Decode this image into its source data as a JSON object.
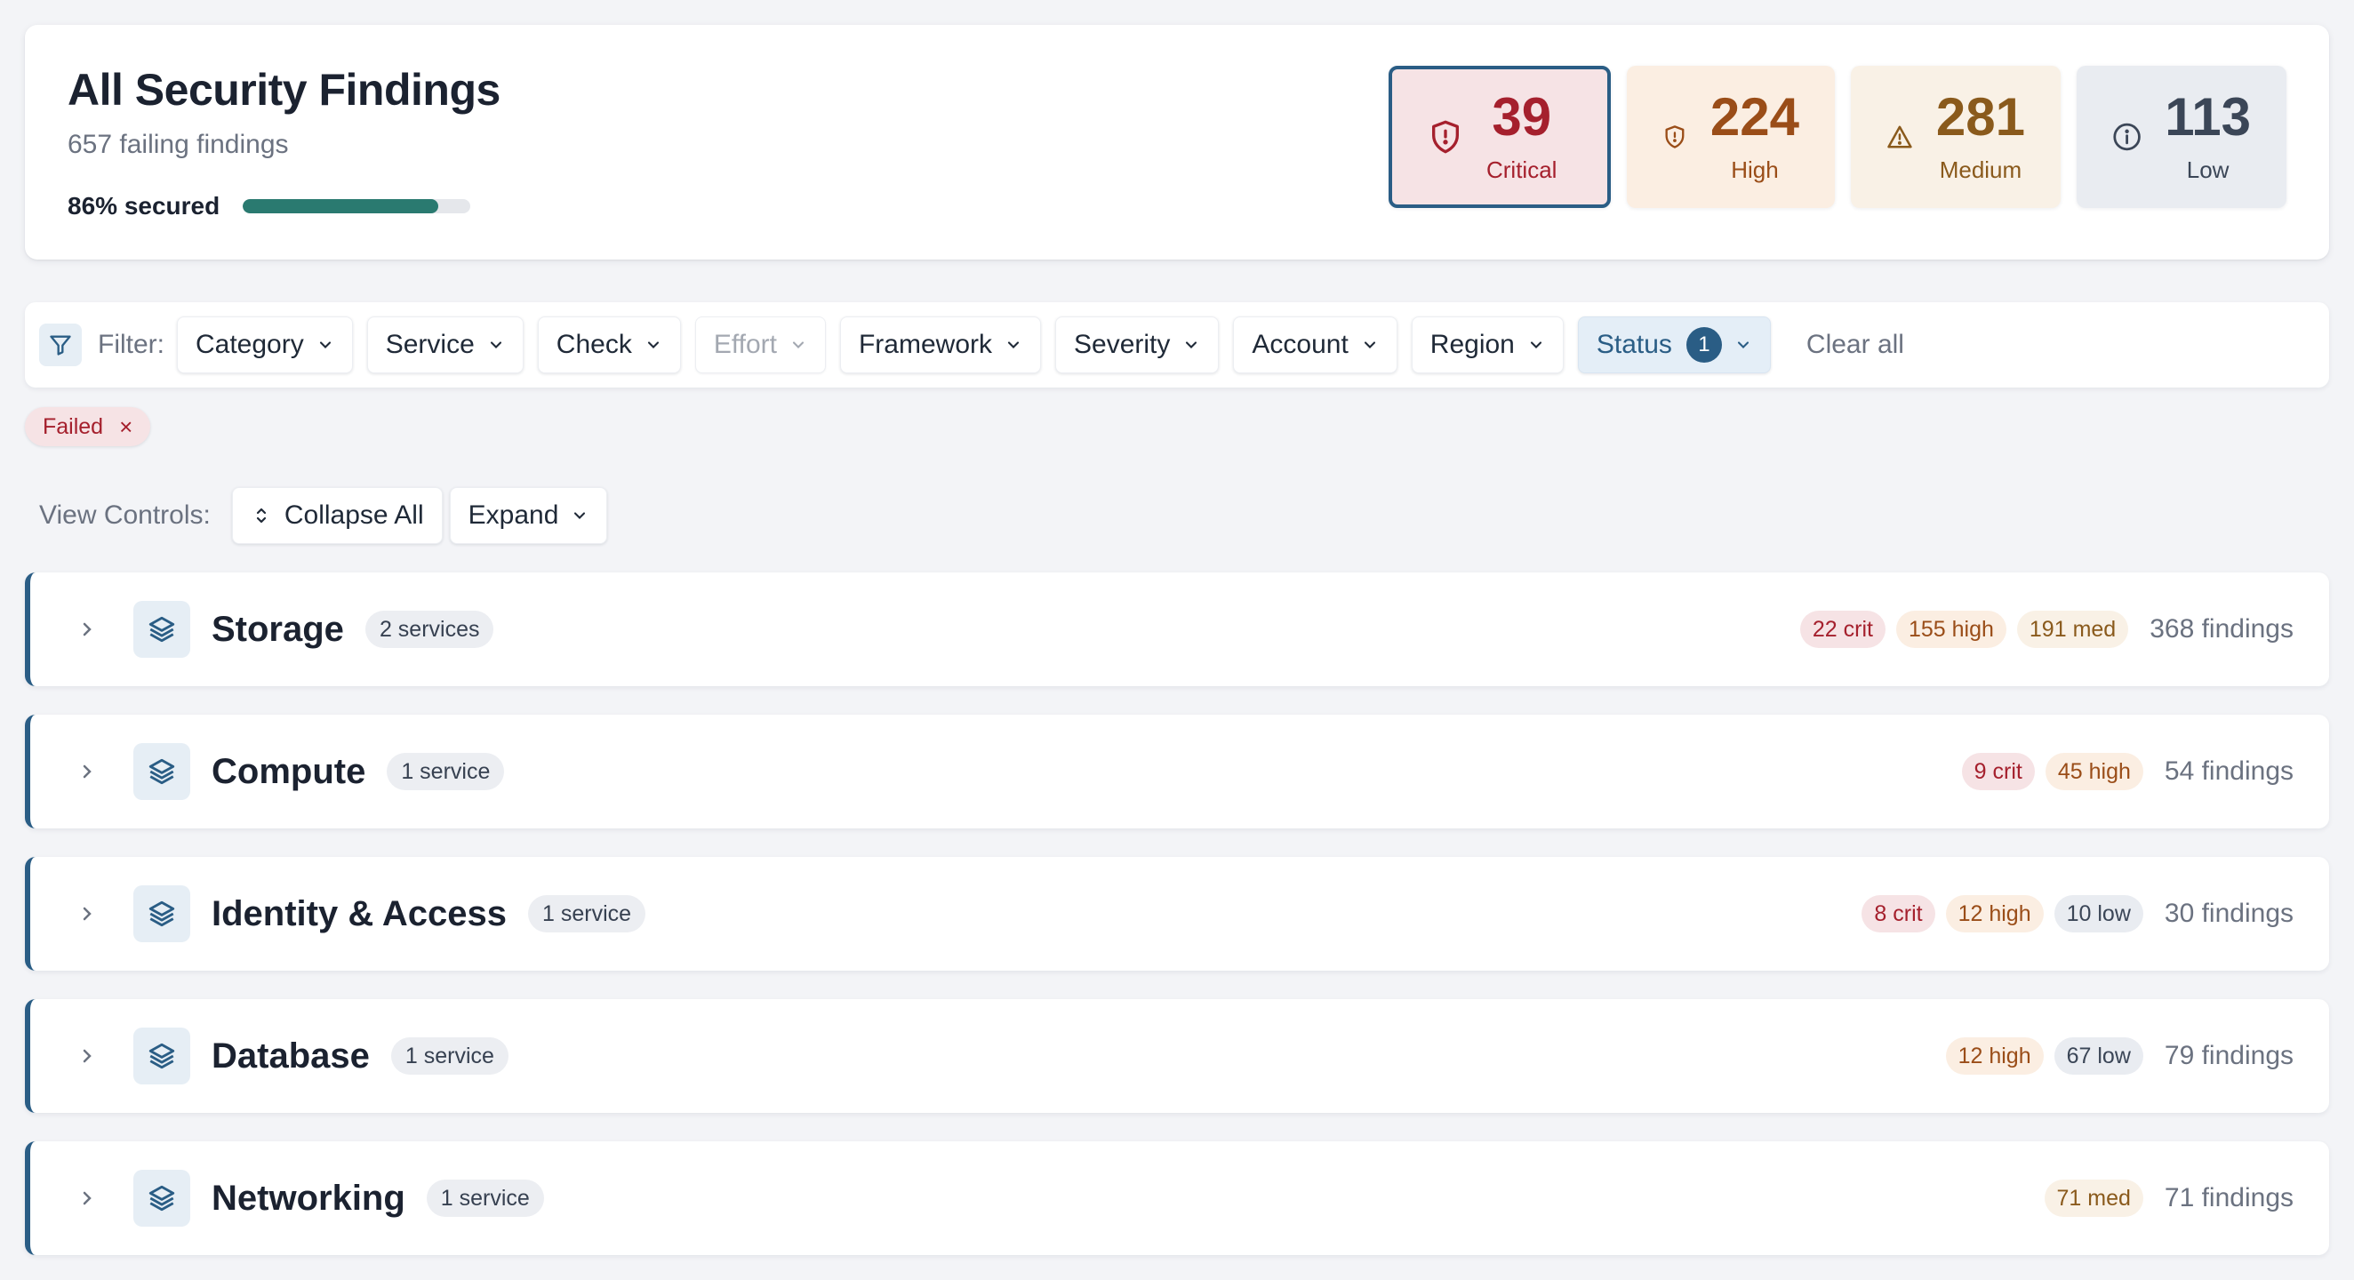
{
  "header": {
    "title": "All Security Findings",
    "subtitle": "657 failing findings",
    "secured_label": "86% secured",
    "secured_fraction": 0.86
  },
  "severity_cards": [
    {
      "key": "critical",
      "count": "39",
      "label": "Critical",
      "icon": "shield-alert-icon"
    },
    {
      "key": "high",
      "count": "224",
      "label": "High",
      "icon": "shield-alert-icon"
    },
    {
      "key": "medium",
      "count": "281",
      "label": "Medium",
      "icon": "warning-triangle-icon"
    },
    {
      "key": "low",
      "count": "113",
      "label": "Low",
      "icon": "info-circle-icon"
    }
  ],
  "filters": {
    "label": "Filter:",
    "buttons": [
      {
        "label": "Category",
        "state": "normal"
      },
      {
        "label": "Service",
        "state": "normal"
      },
      {
        "label": "Check",
        "state": "normal"
      },
      {
        "label": "Effort",
        "state": "disabled"
      },
      {
        "label": "Framework",
        "state": "normal"
      },
      {
        "label": "Severity",
        "state": "normal"
      },
      {
        "label": "Account",
        "state": "normal"
      },
      {
        "label": "Region",
        "state": "normal"
      },
      {
        "label": "Status",
        "state": "active",
        "count": "1"
      }
    ],
    "clear_all": "Clear all"
  },
  "active_chips": [
    {
      "label": "Failed",
      "remove_icon": "close-icon"
    }
  ],
  "view_controls": {
    "label": "View Controls:",
    "collapse_all": "Collapse All",
    "expand": "Expand"
  },
  "categories": [
    {
      "name": "Storage",
      "services": "2 services",
      "pills": [
        {
          "type": "crit",
          "text": "22 crit"
        },
        {
          "type": "high",
          "text": "155 high"
        },
        {
          "type": "med",
          "text": "191 med"
        }
      ],
      "findings": "368 findings"
    },
    {
      "name": "Compute",
      "services": "1 service",
      "pills": [
        {
          "type": "crit",
          "text": "9 crit"
        },
        {
          "type": "high",
          "text": "45 high"
        }
      ],
      "findings": "54 findings"
    },
    {
      "name": "Identity & Access",
      "services": "1 service",
      "pills": [
        {
          "type": "crit",
          "text": "8 crit"
        },
        {
          "type": "high",
          "text": "12 high"
        },
        {
          "type": "low",
          "text": "10 low"
        }
      ],
      "findings": "30 findings"
    },
    {
      "name": "Database",
      "services": "1 service",
      "pills": [
        {
          "type": "high",
          "text": "12 high"
        },
        {
          "type": "low",
          "text": "67 low"
        }
      ],
      "findings": "79 findings"
    },
    {
      "name": "Networking",
      "services": "1 service",
      "pills": [
        {
          "type": "med",
          "text": "71 med"
        }
      ],
      "findings": "71 findings"
    }
  ],
  "colors": {
    "accent": "#2a5d85",
    "progress": "#2a7a70",
    "critical": "#a5202d",
    "high": "#9a4d18",
    "medium": "#8a5a1c",
    "low": "#3b4657"
  }
}
